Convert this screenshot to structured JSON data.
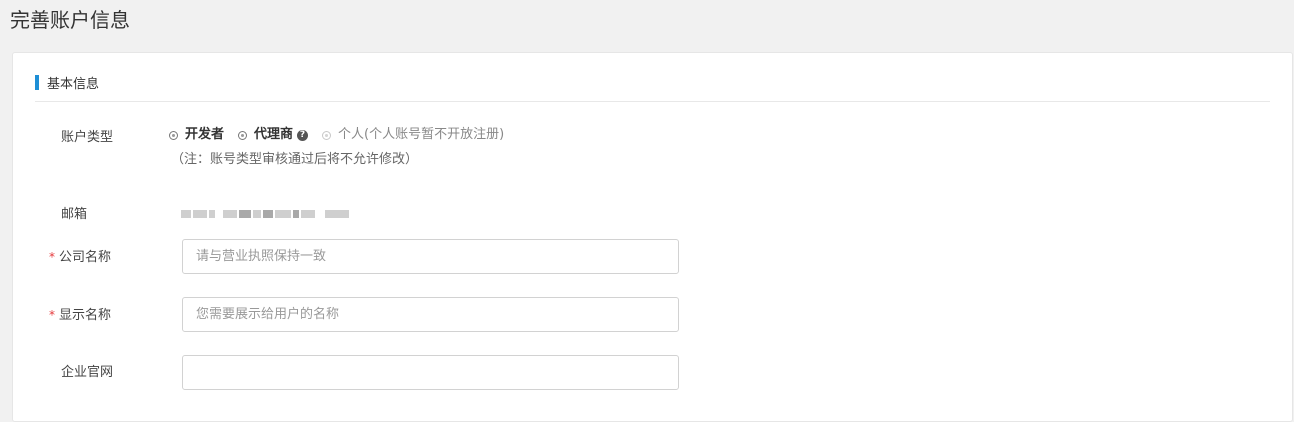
{
  "page": {
    "title": "完善账户信息"
  },
  "section": {
    "title": "基本信息",
    "accent_color": "#1e8fd6"
  },
  "form": {
    "account_type": {
      "label": "账户类型",
      "options": [
        {
          "label": "开发者",
          "disabled": false
        },
        {
          "label": "代理商",
          "disabled": false,
          "help_icon": "question-circle-icon"
        },
        {
          "label": "个人(个人账号暂不开放注册)",
          "disabled": true
        }
      ],
      "note": "（注：账号类型审核通过后将不允许修改）"
    },
    "email": {
      "label": "邮箱",
      "value_masked": true
    },
    "company_name": {
      "required_mark": "*",
      "label": "公司名称",
      "value": "",
      "placeholder": "请与营业执照保持一致"
    },
    "display_name": {
      "required_mark": "*",
      "label": "显示名称",
      "value": "",
      "placeholder": "您需要展示给用户的名称"
    },
    "website": {
      "label": "企业官网",
      "value": "",
      "placeholder": ""
    }
  },
  "colors": {
    "required": "#e4393c",
    "background": "#f1f1f1"
  }
}
